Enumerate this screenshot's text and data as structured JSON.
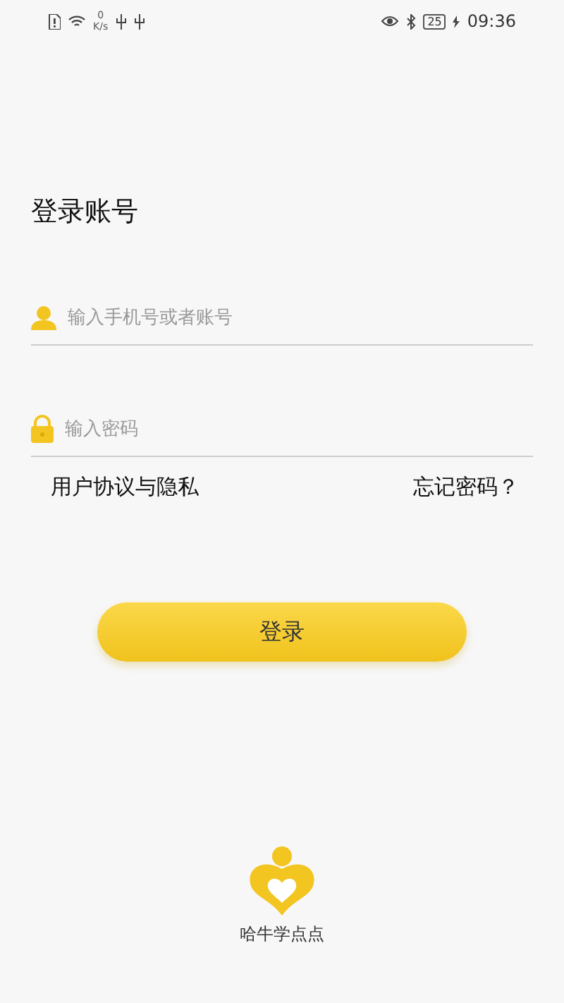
{
  "status_bar": {
    "speed_value": "0",
    "speed_unit": "K/s",
    "battery": "25",
    "time": "09:36"
  },
  "title": "登录账号",
  "fields": [
    {
      "kind": "user",
      "placeholder": "输入手机号或者账号"
    },
    {
      "kind": "lock",
      "placeholder": "输入密码"
    }
  ],
  "links": {
    "agreement": "用户协议与隐私",
    "forgot": "忘记密码？"
  },
  "login_button": "登录",
  "app_name": "哈牛学点点"
}
